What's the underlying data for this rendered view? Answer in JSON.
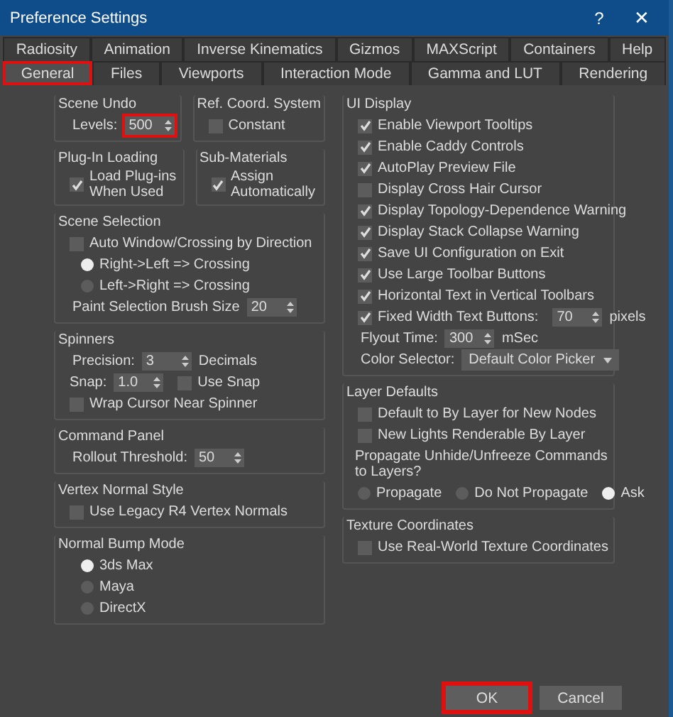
{
  "window": {
    "title": "Preference Settings",
    "help": "?",
    "close": "✕"
  },
  "tab_rows": [
    [
      {
        "label": "Radiosity",
        "selected": false,
        "highlighted": false
      },
      {
        "label": "Animation",
        "selected": false,
        "highlighted": false
      },
      {
        "label": "Inverse Kinematics",
        "selected": false,
        "highlighted": false
      },
      {
        "label": "Gizmos",
        "selected": false,
        "highlighted": false
      },
      {
        "label": "MAXScript",
        "selected": false,
        "highlighted": false
      },
      {
        "label": "Containers",
        "selected": false,
        "highlighted": false
      },
      {
        "label": "Help",
        "selected": false,
        "highlighted": false
      }
    ],
    [
      {
        "label": "General",
        "selected": true,
        "highlighted": true
      },
      {
        "label": "Files",
        "selected": false,
        "highlighted": false
      },
      {
        "label": "Viewports",
        "selected": false,
        "highlighted": false
      },
      {
        "label": "Interaction Mode",
        "selected": false,
        "highlighted": false
      },
      {
        "label": "Gamma and LUT",
        "selected": false,
        "highlighted": false
      },
      {
        "label": "Rendering",
        "selected": false,
        "highlighted": false
      }
    ]
  ],
  "left_column": [
    [
      {
        "title": "Scene Undo",
        "items": [
          {
            "kind": "spinner",
            "label": "Levels:",
            "value": "500",
            "highlighted": true
          }
        ]
      },
      {
        "title": "Ref. Coord. System",
        "items": [
          {
            "kind": "checkbox",
            "label": "Constant",
            "checked": false
          }
        ]
      }
    ],
    [
      {
        "title": "Plug-In Loading",
        "items": [
          {
            "kind": "checkbox",
            "label": "Load Plug-ins When Used",
            "checked": true
          }
        ]
      },
      {
        "title": "Sub-Materials",
        "items": [
          {
            "kind": "checkbox",
            "label": "Assign Automatically",
            "checked": true
          }
        ]
      }
    ],
    [
      {
        "title": "Scene Selection",
        "items": [
          {
            "kind": "checkbox",
            "label": "Auto Window/Crossing by Direction",
            "checked": false
          },
          {
            "kind": "radio",
            "label": "Right->Left => Crossing",
            "selected": true
          },
          {
            "kind": "radio",
            "label": "Left->Right => Crossing",
            "selected": false
          },
          {
            "kind": "spinner",
            "label": "Paint Selection Brush Size",
            "value": "20",
            "highlighted": false
          }
        ]
      }
    ],
    [
      {
        "title": "Spinners",
        "items": [
          {
            "kind": "spinner",
            "label": "Precision:",
            "value": "3",
            "unit": "Decimals",
            "highlighted": false
          },
          {
            "kind": "line",
            "items": [
              {
                "kind": "spinner",
                "label": "Snap:",
                "value": "1.0",
                "highlighted": false
              },
              {
                "kind": "checkbox",
                "label": "Use Snap",
                "checked": false
              }
            ]
          },
          {
            "kind": "checkbox",
            "label": "Wrap Cursor Near Spinner",
            "checked": false
          }
        ]
      }
    ],
    [
      {
        "title": "Command Panel",
        "items": [
          {
            "kind": "spinner",
            "label": "Rollout Threshold:",
            "value": "50",
            "highlighted": false
          }
        ]
      }
    ],
    [
      {
        "title": "Vertex Normal Style",
        "items": [
          {
            "kind": "checkbox",
            "label": "Use Legacy R4 Vertex Normals",
            "checked": false
          }
        ]
      }
    ],
    [
      {
        "title": "Normal Bump Mode",
        "items": [
          {
            "kind": "radio",
            "label": "3ds Max",
            "selected": true
          },
          {
            "kind": "radio",
            "label": "Maya",
            "selected": false
          },
          {
            "kind": "radio",
            "label": "DirectX",
            "selected": false
          }
        ]
      }
    ]
  ],
  "right_column": [
    {
      "title": "UI Display",
      "items": [
        {
          "kind": "checkbox",
          "label": "Enable Viewport Tooltips",
          "checked": true
        },
        {
          "kind": "checkbox",
          "label": "Enable Caddy Controls",
          "checked": true
        },
        {
          "kind": "checkbox",
          "label": "AutoPlay Preview File",
          "checked": true
        },
        {
          "kind": "checkbox",
          "label": "Display Cross Hair Cursor",
          "checked": false
        },
        {
          "kind": "checkbox",
          "label": "Display Topology-Dependence Warning",
          "checked": true
        },
        {
          "kind": "checkbox",
          "label": "Display Stack Collapse Warning",
          "checked": true
        },
        {
          "kind": "checkbox",
          "label": "Save UI Configuration on Exit",
          "checked": true
        },
        {
          "kind": "checkbox",
          "label": "Use Large Toolbar Buttons",
          "checked": true
        },
        {
          "kind": "checkbox",
          "label": "Horizontal Text in Vertical Toolbars",
          "checked": true
        },
        {
          "kind": "line",
          "items": [
            {
              "kind": "checkbox",
              "label": "Fixed Width Text Buttons:",
              "checked": true
            },
            {
              "kind": "spinner",
              "value": "70",
              "unit": "pixels",
              "highlighted": false
            }
          ]
        },
        {
          "kind": "spinner",
          "label": "Flyout Time:",
          "value": "300",
          "unit": "mSec",
          "highlighted": false
        },
        {
          "kind": "dropdown",
          "label": "Color Selector:",
          "value": "Default Color Picker"
        }
      ]
    },
    {
      "title": "Layer Defaults",
      "items": [
        {
          "kind": "checkbox",
          "label": "Default to By Layer for New Nodes",
          "checked": false
        },
        {
          "kind": "checkbox",
          "label": "New Lights Renderable By Layer",
          "checked": false
        },
        {
          "kind": "text",
          "text": "Propagate Unhide/Unfreeze Commands to Layers?"
        },
        {
          "kind": "line",
          "items": [
            {
              "kind": "radio",
              "label": "Propagate",
              "selected": false
            },
            {
              "kind": "radio",
              "label": "Do Not Propagate",
              "selected": false
            },
            {
              "kind": "radio",
              "label": "Ask",
              "selected": true
            }
          ]
        }
      ]
    },
    {
      "title": "Texture Coordinates",
      "items": [
        {
          "kind": "checkbox",
          "label": "Use Real-World Texture Coordinates",
          "checked": false
        }
      ]
    }
  ],
  "buttons": [
    {
      "label": "OK",
      "highlighted": true
    },
    {
      "label": "Cancel",
      "highlighted": false
    }
  ]
}
